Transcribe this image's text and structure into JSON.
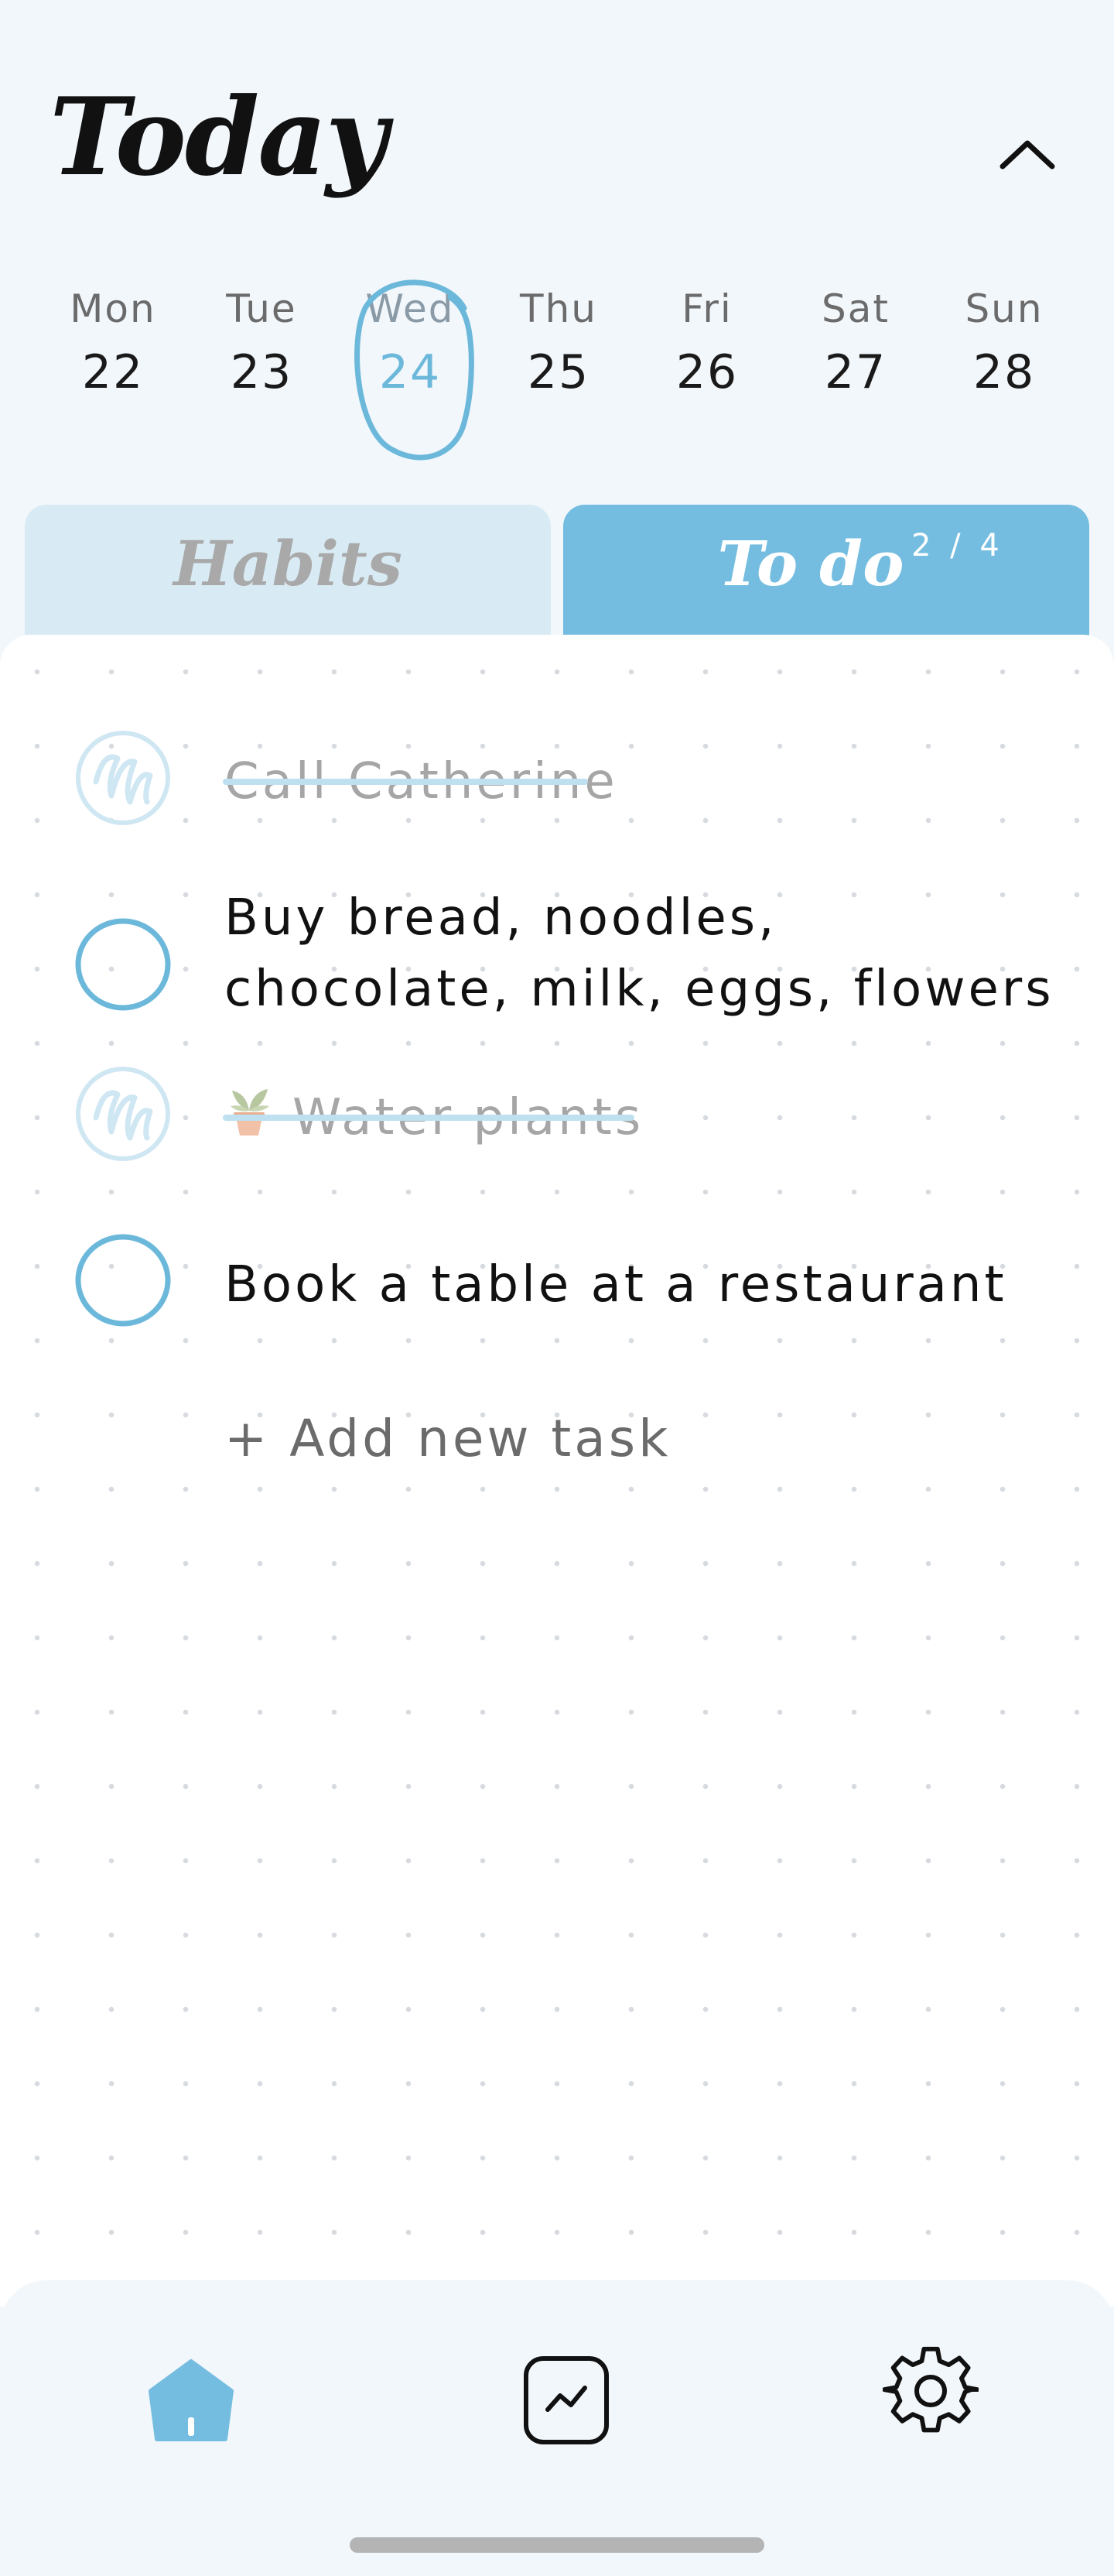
{
  "header": {
    "title": "Today",
    "collapse_icon": "chevron-up-icon"
  },
  "week": {
    "days": [
      {
        "name": "Mon",
        "date": "22"
      },
      {
        "name": "Tue",
        "date": "23"
      },
      {
        "name": "Wed",
        "date": "24",
        "selected": true
      },
      {
        "name": "Thu",
        "date": "25"
      },
      {
        "name": "Fri",
        "date": "26"
      },
      {
        "name": "Sat",
        "date": "27"
      },
      {
        "name": "Sun",
        "date": "28"
      }
    ]
  },
  "tabs": {
    "habits": {
      "label": "Habits"
    },
    "todo": {
      "label": "To do",
      "count": "2 / 4",
      "active": true
    }
  },
  "tasks": [
    {
      "text": "Call Catherine",
      "done": true
    },
    {
      "text": "Buy bread, noodles, chocolate, milk, eggs, flowers",
      "done": false
    },
    {
      "text": "Water plants",
      "done": true,
      "icon": "potted-plant-icon"
    },
    {
      "text": "Book a table at a restaurant",
      "done": false
    }
  ],
  "add_task_label": "+ Add new task",
  "nav": {
    "items": [
      {
        "icon": "home-icon",
        "active": true
      },
      {
        "icon": "stats-chart-icon",
        "active": false
      },
      {
        "icon": "settings-gear-icon",
        "active": false
      }
    ]
  },
  "colors": {
    "accent": "#75bde0",
    "accent_light": "#d8ebf4",
    "background": "#f2f7fb",
    "done_text": "#a6a6a6"
  }
}
